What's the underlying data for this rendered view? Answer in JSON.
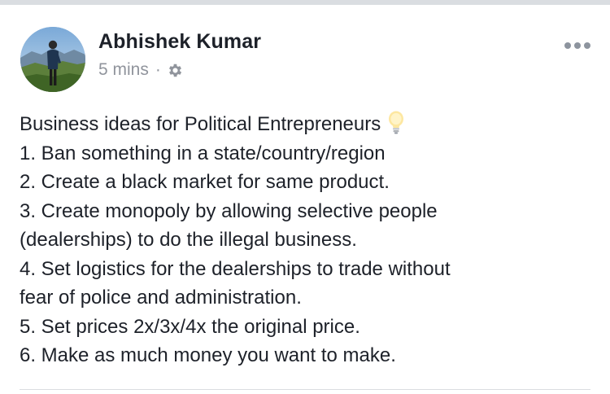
{
  "post": {
    "author": "Abhishek Kumar",
    "timestamp": "5 mins",
    "separator": "·",
    "privacy_icon": "gear-icon",
    "options_icon": "more-options-icon",
    "lines": [
      "Business ideas for Political Entrepreneurs",
      "1. Ban something in a state/country/region",
      "2. Create a black market for same product.",
      "3. Create monopoly by allowing selective people",
      "(dealerships) to do the illegal business.",
      "4. Set logistics for the dealerships to trade without",
      "fear of police and administration.",
      "5. Set prices 2x/3x/4x the original price.",
      "6. Make as much money you want to make."
    ],
    "title_emoji_icon": "lightbulb-icon"
  },
  "colors": {
    "text": "#1d2129",
    "meta": "#90949c",
    "divider": "#dadde1"
  }
}
